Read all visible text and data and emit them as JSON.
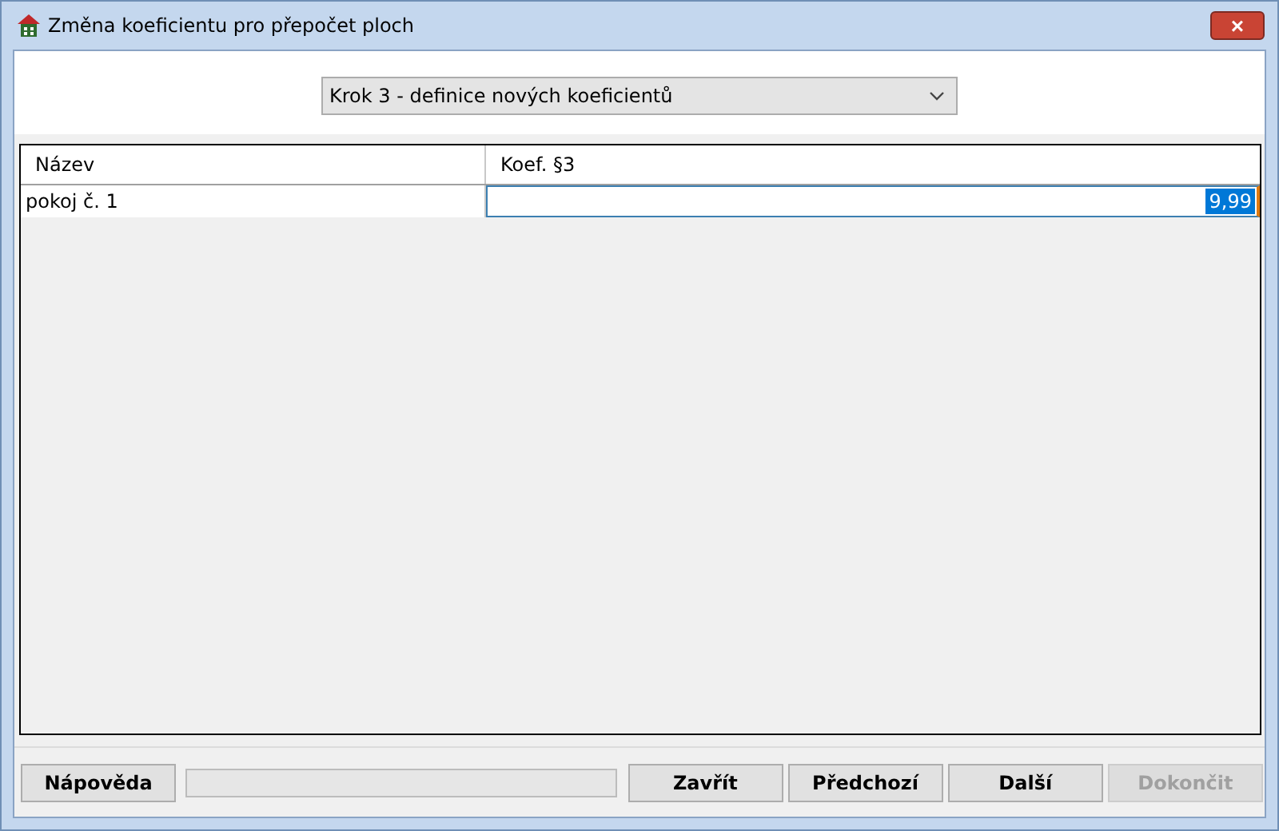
{
  "window": {
    "title": "Změna koeficientu pro přepočet ploch",
    "close": "×"
  },
  "step_select": {
    "value": "Krok 3 - definice nových koeficientů"
  },
  "table": {
    "columns": [
      "Název",
      "Koef. §3"
    ],
    "rows": [
      {
        "name": "pokoj č. 1",
        "value": "9,99",
        "editing": true
      }
    ]
  },
  "progress": {
    "level": 0
  },
  "buttons": [
    {
      "label": "Nápověda",
      "disabled": false
    },
    {
      "label": "Zavřít",
      "disabled": false
    },
    {
      "label": "Předchozí",
      "disabled": false
    },
    {
      "label": "Další",
      "disabled": false
    },
    {
      "label": "Dokončit",
      "disabled": true
    }
  ]
}
